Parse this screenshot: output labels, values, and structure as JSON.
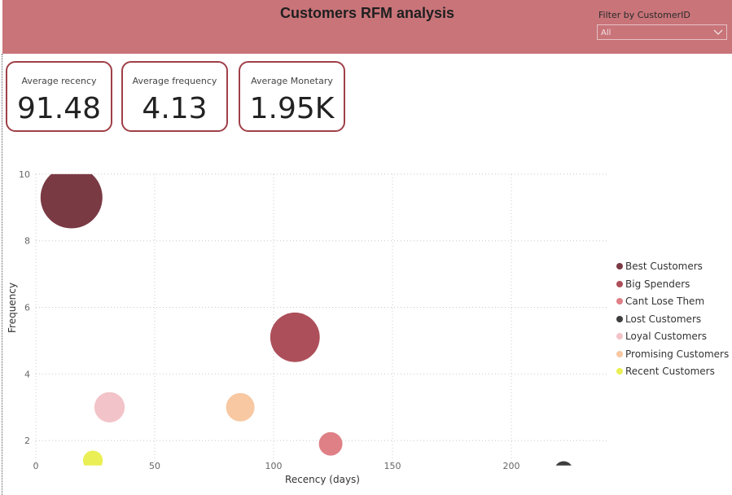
{
  "title": "Customers RFM analysis",
  "filter": {
    "label": "Filter by CustomerID",
    "value": "All"
  },
  "cards": [
    {
      "label": "Average recency",
      "value": "91.48"
    },
    {
      "label": "Average frequency",
      "value": "4.13"
    },
    {
      "label": "Average Monetary",
      "value": "1.95K"
    }
  ],
  "chart_data": {
    "type": "scatter",
    "title": "",
    "xlabel": "Recency (days)",
    "ylabel": "Frequency",
    "xlim": [
      0,
      240
    ],
    "ylim": [
      1,
      10
    ],
    "xticks": [
      0,
      50,
      100,
      150,
      200
    ],
    "yticks": [
      2,
      4,
      6,
      8,
      10
    ],
    "grid": true,
    "legend_position": "right",
    "series": [
      {
        "name": "Best Customers",
        "color": "#7a3a44",
        "points": [
          {
            "x": 15,
            "y": 9.3,
            "size": 1.0
          }
        ]
      },
      {
        "name": "Big Spenders",
        "color": "#ad4f5a",
        "points": [
          {
            "x": 109,
            "y": 5.1,
            "size": 0.8
          }
        ]
      },
      {
        "name": "Cant Lose Them",
        "color": "#df7f86",
        "points": [
          {
            "x": 124,
            "y": 1.9,
            "size": 0.38
          }
        ]
      },
      {
        "name": "Lost Customers",
        "color": "#3e3e3e",
        "points": [
          {
            "x": 222,
            "y": 1.1,
            "size": 0.3
          }
        ]
      },
      {
        "name": "Loyal Customers",
        "color": "#f2c3c8",
        "points": [
          {
            "x": 31,
            "y": 3.0,
            "size": 0.49
          }
        ]
      },
      {
        "name": "Promising Customers",
        "color": "#f7c8a2",
        "points": [
          {
            "x": 86,
            "y": 3.0,
            "size": 0.46
          }
        ]
      },
      {
        "name": "Recent Customers",
        "color": "#eaef55",
        "points": [
          {
            "x": 24,
            "y": 1.4,
            "size": 0.32
          }
        ]
      }
    ]
  }
}
